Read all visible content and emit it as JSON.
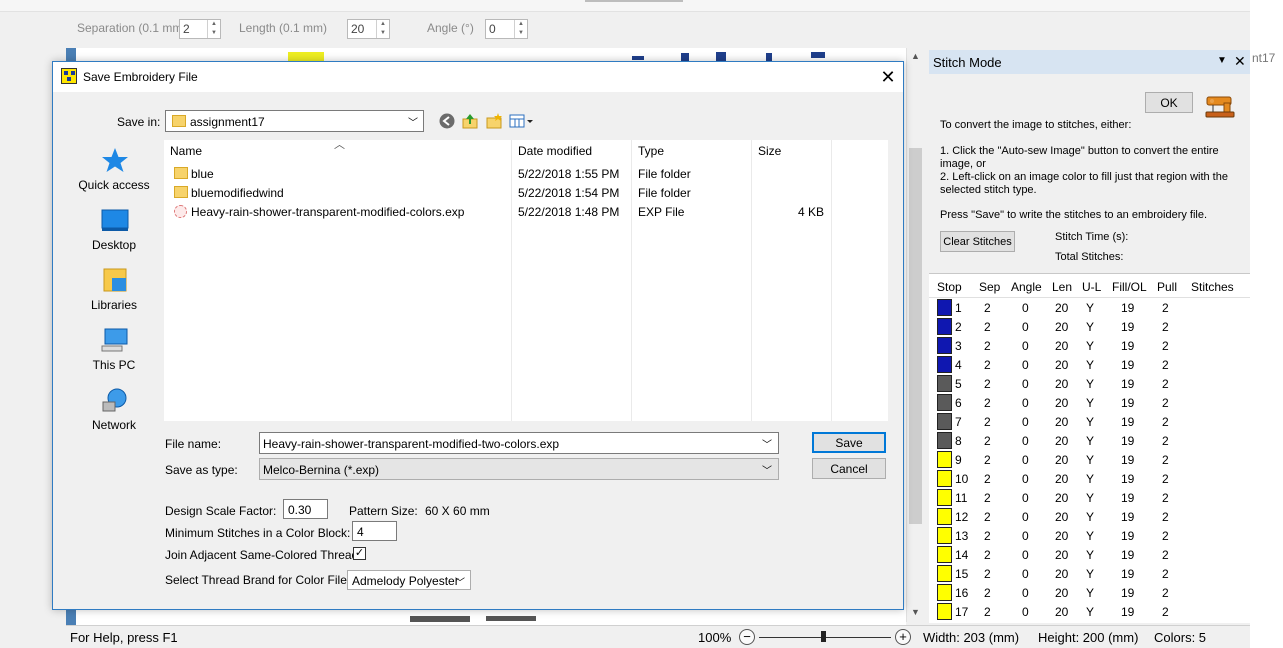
{
  "toolbar": {
    "separation_label": "Separation (0.1 mm)",
    "separation_value": "2",
    "length_label": "Length (0.1 mm)",
    "length_value": "20",
    "angle_label": "Angle (°)",
    "angle_value": "0"
  },
  "background_caption": "nt17",
  "dialog": {
    "title": "Save Embroidery File",
    "save_in_label": "Save in:",
    "save_in_value": "assignment17",
    "places": [
      {
        "label": "Quick access",
        "icon": "star-icon"
      },
      {
        "label": "Desktop",
        "icon": "desktop-icon"
      },
      {
        "label": "Libraries",
        "icon": "libraries-icon"
      },
      {
        "label": "This PC",
        "icon": "computer-icon"
      },
      {
        "label": "Network",
        "icon": "network-icon"
      }
    ],
    "columns": {
      "name": "Name",
      "date": "Date modified",
      "type": "Type",
      "size": "Size"
    },
    "files": [
      {
        "name": "blue",
        "date": "5/22/2018 1:55 PM",
        "type": "File folder",
        "size": "",
        "icon": "folder-icon"
      },
      {
        "name": "bluemodifiedwind",
        "date": "5/22/2018 1:54 PM",
        "type": "File folder",
        "size": "",
        "icon": "folder-icon"
      },
      {
        "name": "Heavy-rain-shower-transparent-modified-colors.exp",
        "date": "5/22/2018 1:48 PM",
        "type": "EXP File",
        "size": "4 KB",
        "icon": "embroidery-file-icon"
      }
    ],
    "filename_label": "File name:",
    "filename_value": "Heavy-rain-shower-transparent-modified-two-colors.exp",
    "savetype_label": "Save as type:",
    "savetype_value": "Melco-Bernina (*.exp)",
    "save_button": "Save",
    "cancel_button": "Cancel",
    "scale_label": "Design Scale Factor:",
    "scale_value": "0.30",
    "pattern_size_label": "Pattern Size:",
    "pattern_size_value": "60 X 60 mm",
    "min_stitches_label": "Minimum Stitches in a Color Block:",
    "min_stitches_value": "4",
    "join_label": "Join Adjacent Same-Colored Threads",
    "join_checked": "✓",
    "thread_brand_label": "Select Thread Brand for Color File",
    "thread_brand_value": "Admelody Polyester"
  },
  "stitch_panel": {
    "title": "Stitch Mode",
    "ok_button": "OK",
    "instruction_intro": "To convert the image to stitches, either:",
    "instruction_1": "1. Click the \"Auto-sew Image\" button to convert the entire image, or",
    "instruction_2": "2. Left-click on an image color to fill just that region with the selected stitch type.",
    "instruction_save": "Press \"Save\" to write the stitches to an embroidery file.",
    "clear_button": "Clear Stitches",
    "stitch_time_label": "Stitch Time (s):",
    "total_stitches_label": "Total Stitches:",
    "columns": [
      "Stop",
      "Sep",
      "Angle",
      "Len",
      "U-L",
      "Fill/OL",
      "Pull",
      "Stitches"
    ],
    "colors": {
      "blue": "#0f17b0",
      "gray": "#5a5a5a",
      "yellow": "#ffff00"
    },
    "rows": [
      {
        "stop": "1",
        "sep": "2",
        "angle": "0",
        "len": "20",
        "ul": "Y",
        "fill": "19",
        "pull": "2",
        "color": "blue"
      },
      {
        "stop": "2",
        "sep": "2",
        "angle": "0",
        "len": "20",
        "ul": "Y",
        "fill": "19",
        "pull": "2",
        "color": "blue"
      },
      {
        "stop": "3",
        "sep": "2",
        "angle": "0",
        "len": "20",
        "ul": "Y",
        "fill": "19",
        "pull": "2",
        "color": "blue"
      },
      {
        "stop": "4",
        "sep": "2",
        "angle": "0",
        "len": "20",
        "ul": "Y",
        "fill": "19",
        "pull": "2",
        "color": "blue"
      },
      {
        "stop": "5",
        "sep": "2",
        "angle": "0",
        "len": "20",
        "ul": "Y",
        "fill": "19",
        "pull": "2",
        "color": "gray"
      },
      {
        "stop": "6",
        "sep": "2",
        "angle": "0",
        "len": "20",
        "ul": "Y",
        "fill": "19",
        "pull": "2",
        "color": "gray"
      },
      {
        "stop": "7",
        "sep": "2",
        "angle": "0",
        "len": "20",
        "ul": "Y",
        "fill": "19",
        "pull": "2",
        "color": "gray"
      },
      {
        "stop": "8",
        "sep": "2",
        "angle": "0",
        "len": "20",
        "ul": "Y",
        "fill": "19",
        "pull": "2",
        "color": "gray"
      },
      {
        "stop": "9",
        "sep": "2",
        "angle": "0",
        "len": "20",
        "ul": "Y",
        "fill": "19",
        "pull": "2",
        "color": "yellow"
      },
      {
        "stop": "10",
        "sep": "2",
        "angle": "0",
        "len": "20",
        "ul": "Y",
        "fill": "19",
        "pull": "2",
        "color": "yellow"
      },
      {
        "stop": "11",
        "sep": "2",
        "angle": "0",
        "len": "20",
        "ul": "Y",
        "fill": "19",
        "pull": "2",
        "color": "yellow"
      },
      {
        "stop": "12",
        "sep": "2",
        "angle": "0",
        "len": "20",
        "ul": "Y",
        "fill": "19",
        "pull": "2",
        "color": "yellow"
      },
      {
        "stop": "13",
        "sep": "2",
        "angle": "0",
        "len": "20",
        "ul": "Y",
        "fill": "19",
        "pull": "2",
        "color": "yellow"
      },
      {
        "stop": "14",
        "sep": "2",
        "angle": "0",
        "len": "20",
        "ul": "Y",
        "fill": "19",
        "pull": "2",
        "color": "yellow"
      },
      {
        "stop": "15",
        "sep": "2",
        "angle": "0",
        "len": "20",
        "ul": "Y",
        "fill": "19",
        "pull": "2",
        "color": "yellow"
      },
      {
        "stop": "16",
        "sep": "2",
        "angle": "0",
        "len": "20",
        "ul": "Y",
        "fill": "19",
        "pull": "2",
        "color": "yellow"
      },
      {
        "stop": "17",
        "sep": "2",
        "angle": "0",
        "len": "20",
        "ul": "Y",
        "fill": "19",
        "pull": "2",
        "color": "yellow"
      }
    ]
  },
  "status_bar": {
    "help": "For Help, press F1",
    "zoom": "100%",
    "zoom_out": "−",
    "zoom_in": "+",
    "width": "Width: 203 (mm)",
    "height": "Height: 200 (mm)",
    "colors": "Colors: 5"
  }
}
